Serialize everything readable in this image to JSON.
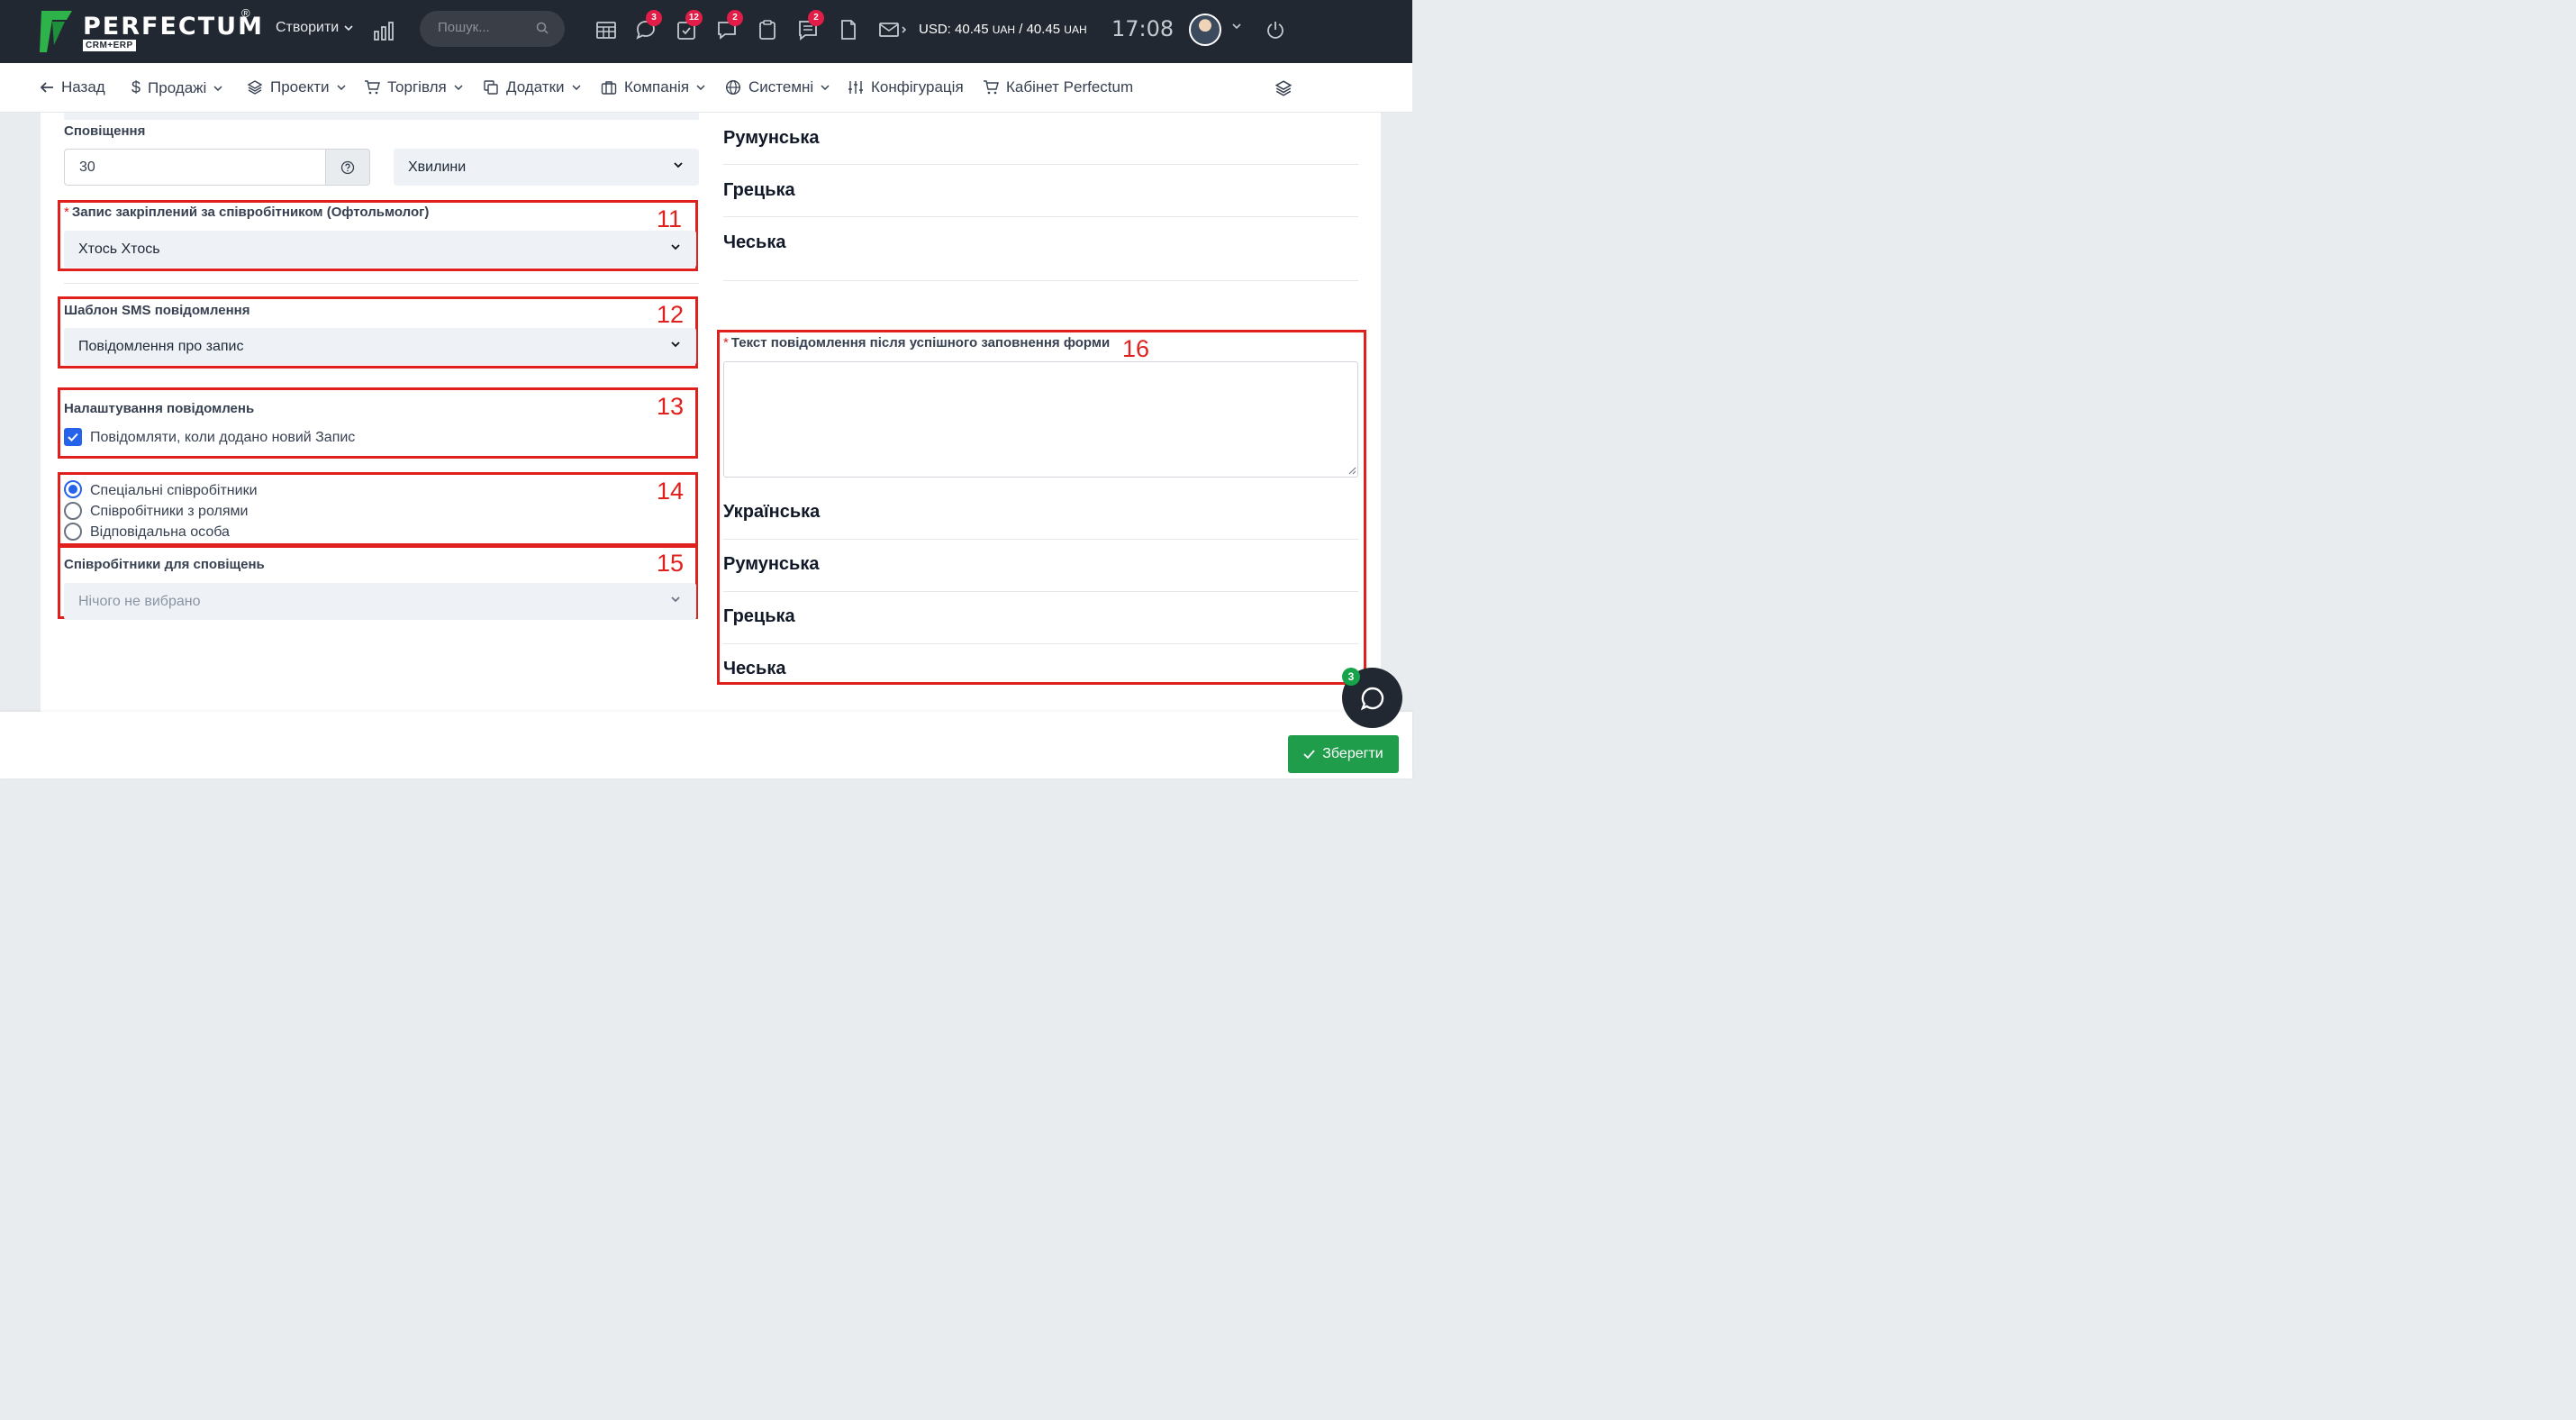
{
  "topbar": {
    "logo_text": "PERFECTUM",
    "logo_reg": "®",
    "logo_sub": "CRM+ERP",
    "create_label": "Створити",
    "search_placeholder": "Пошук...",
    "badges": {
      "chat": "3",
      "tasks": "12",
      "comments": "2",
      "messages": "2"
    },
    "currency_main": "USD: 40.45",
    "currency_unit1": "UAH",
    "currency_sep": "/ 40.45",
    "currency_unit2": "UAH",
    "clock": "17:08"
  },
  "nav": {
    "back": "Назад",
    "sales": "Продажі",
    "projects": "Проекти",
    "trade": "Торгівля",
    "addons": "Додатки",
    "company": "Компанія",
    "system": "Системні",
    "config": "Конфігурація",
    "cabinet": "Кабінет Perfectum"
  },
  "form": {
    "notification_label": "Сповіщення",
    "notification_value": "30",
    "notification_unit": "Хвилини",
    "assigned_label": "Запис закріплений за співробітником (Офтольмолог)",
    "assigned_value": "Хтось Хтось",
    "sms_label": "Шаблон SMS повідомлення",
    "sms_value": "Повідомлення про запис",
    "notify_settings_label": "Налаштування повідомлень",
    "notify_checkbox_label": "Повідомляти, коли додано новий Запис",
    "radio_options": [
      "Спеціальні співробітники",
      "Співробітники з ролями",
      "Відповідальна особа"
    ],
    "staff_label": "Співробітники для сповіщень",
    "staff_placeholder": "Нічого не вибрано",
    "success_text_label": "Текст повідомлення після успішного заповнення форми",
    "languages_top": [
      "Румунська",
      "Грецька",
      "Чеська"
    ],
    "languages_bottom": [
      "Українська",
      "Румунська",
      "Грецька",
      "Чеська"
    ]
  },
  "annotations": [
    "11",
    "12",
    "13",
    "14",
    "15",
    "16"
  ],
  "footer": {
    "save_label": "Зберегти",
    "chat_badge": "3"
  },
  "colors": {
    "topbar": "#222831",
    "accent": "#2563eb",
    "annotation": "#e0201d",
    "save": "#1f9d4a",
    "badge": "#e11d48"
  }
}
